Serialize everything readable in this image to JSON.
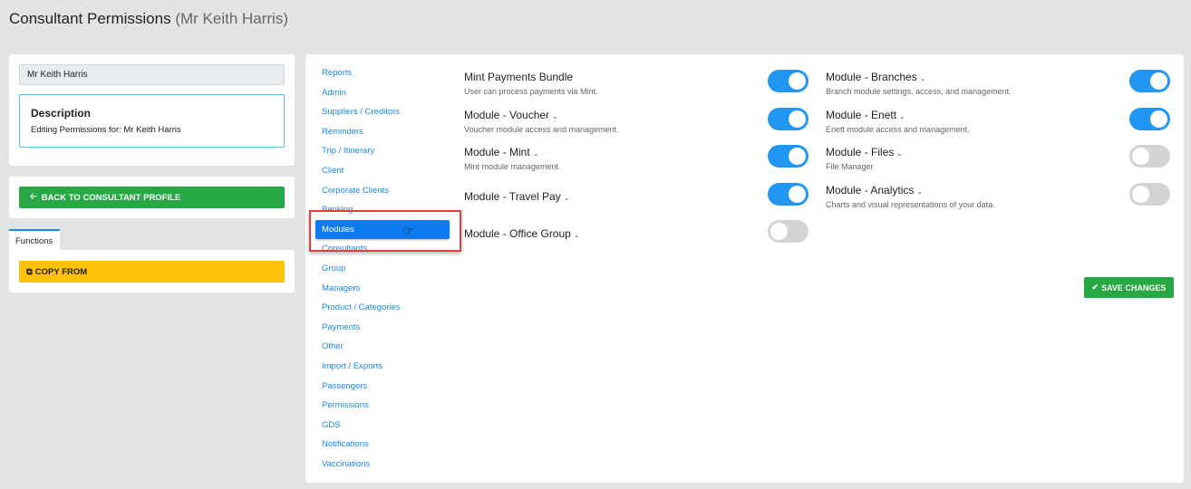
{
  "header": {
    "title": "Consultant Permissions",
    "subtitle": "(Mr Keith Harris)"
  },
  "profile": {
    "name": "Mr Keith Harris",
    "description_title": "Description",
    "description_text": "Editing Permissions for: Mr Keith Harris"
  },
  "back_button": "BACK TO CONSULTANT PROFILE",
  "functions_tab": "Functions",
  "copy_button": "COPY FROM",
  "nav": [
    "Reports",
    "Admin",
    "Suppliers / Creditors",
    "Reminders",
    "Trip / Itinerary",
    "Client",
    "Corporate Clients",
    "Banking",
    "Modules",
    "Consultants",
    "Group",
    "Managers",
    "Product / Categories",
    "Payments",
    "Other",
    "Import / Exports",
    "Passengers",
    "Permissions",
    "GDS",
    "Notifications",
    "Vaccinations"
  ],
  "active_nav": "Modules",
  "permissions_left": [
    {
      "name": "Mint Payments Bundle",
      "desc": "User can process payments via Mint.",
      "on": true,
      "chevron": false
    },
    {
      "name": "Module - Voucher",
      "desc": "Voucher module access and management.",
      "on": true,
      "chevron": true
    },
    {
      "name": "Module - Mint",
      "desc": "Mint module management.",
      "on": true,
      "chevron": true
    },
    {
      "name": "Module - Travel Pay",
      "desc": "",
      "on": true,
      "chevron": true
    },
    {
      "name": "Module - Office Group",
      "desc": "",
      "on": false,
      "chevron": true
    }
  ],
  "permissions_right": [
    {
      "name": "Module - Branches",
      "desc": "Branch module settings, access, and management.",
      "on": true,
      "chevron": true
    },
    {
      "name": "Module - Enett",
      "desc": "Enett module access and management.",
      "on": true,
      "chevron": true
    },
    {
      "name": "Module - Files",
      "desc": "File Manager",
      "on": false,
      "chevron": true
    },
    {
      "name": "Module - Analytics",
      "desc": "Charts and visual representations of your data.",
      "on": false,
      "chevron": true
    }
  ],
  "save_button": "SAVE CHANGES"
}
